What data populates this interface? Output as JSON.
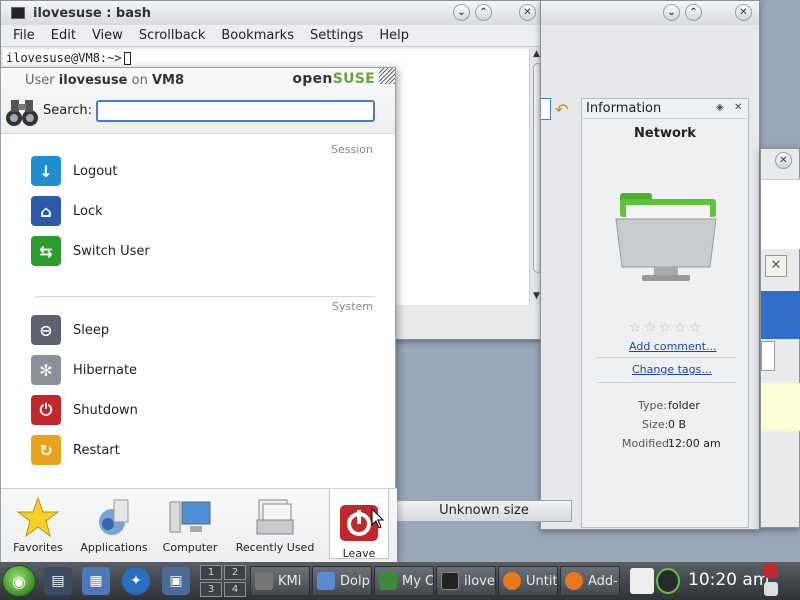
{
  "terminal": {
    "title": "ilovesuse : bash",
    "menu": [
      "File",
      "Edit",
      "View",
      "Scrollback",
      "Bookmarks",
      "Settings",
      "Help"
    ],
    "prompt": "ilovesuse@VM8:~>"
  },
  "info_panel": {
    "header": "Information",
    "title": "Network",
    "add_comment": "Add comment...",
    "change_tags": "Change tags...",
    "rating": 0,
    "type_label": "Type:",
    "type_value": "folder",
    "size_label": "Size:",
    "size_value": "0 B",
    "modified_label": "Modified:",
    "modified_value": "12:00 am"
  },
  "status": {
    "unknown_size": "Unknown size"
  },
  "kickoff": {
    "user_prefix": "User",
    "user_name": "ilovesuse",
    "user_on": "on",
    "host": "VM8",
    "brand_open": "open",
    "brand_suse": "SUSE",
    "search_label": "Search:",
    "search_value": "",
    "session_header": "Session",
    "system_header": "System",
    "session_items": [
      {
        "label": "Logout",
        "icon": "logout-icon",
        "color": "#1f8fd0"
      },
      {
        "label": "Lock",
        "icon": "lock-icon",
        "color": "#2a5aa8"
      },
      {
        "label": "Switch User",
        "icon": "switch-user-icon",
        "color": "#2e9b2e"
      }
    ],
    "system_items": [
      {
        "label": "Sleep",
        "icon": "sleep-icon",
        "color": "#5a6470"
      },
      {
        "label": "Hibernate",
        "icon": "hibernate-icon",
        "color": "#8a9099"
      },
      {
        "label": "Shutdown",
        "icon": "shutdown-icon",
        "color": "#c0282c"
      },
      {
        "label": "Restart",
        "icon": "restart-icon",
        "color": "#e8a21c"
      }
    ],
    "tabs": [
      {
        "label": "Favorites",
        "icon": "star-icon"
      },
      {
        "label": "Applications",
        "icon": "applications-icon"
      },
      {
        "label": "Computer",
        "icon": "computer-icon"
      },
      {
        "label": "Recently Used",
        "icon": "recently-used-icon"
      },
      {
        "label": "Leave",
        "icon": "leave-icon"
      }
    ]
  },
  "taskbar": {
    "pager": [
      "1",
      "2",
      "3",
      "4"
    ],
    "tasks": [
      "KMi",
      "Dolp",
      "My C",
      "ilove",
      "Untit",
      "Add-"
    ],
    "clock": "10:20 am"
  }
}
